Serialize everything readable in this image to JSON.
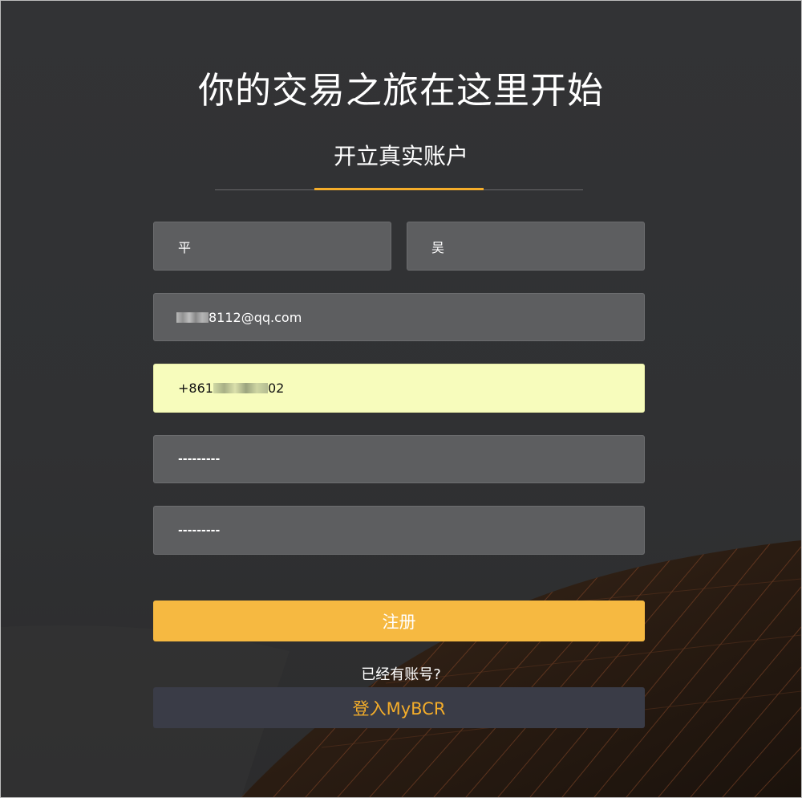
{
  "page": {
    "title": "你的交易之旅在这里开始",
    "tab_label": "开立真实账户"
  },
  "form": {
    "first_name_value": "平",
    "last_name_value": "吴",
    "email_prefix": "",
    "email_value_visible": "8112@qq.com",
    "phone_prefix": "+861",
    "phone_suffix": "02",
    "password_value": "---------",
    "confirm_password_value": "---------"
  },
  "actions": {
    "register_label": "注册",
    "have_account_text": "已经有账号?",
    "login_label": "登入MyBCR"
  },
  "colors": {
    "accent": "#f4ad2a",
    "register_button": "#f6b941",
    "login_button_bg": "#3a3c47",
    "input_bg": "#5d5e60",
    "autofill_bg": "#f7fcbc",
    "page_bg": "#323335"
  }
}
